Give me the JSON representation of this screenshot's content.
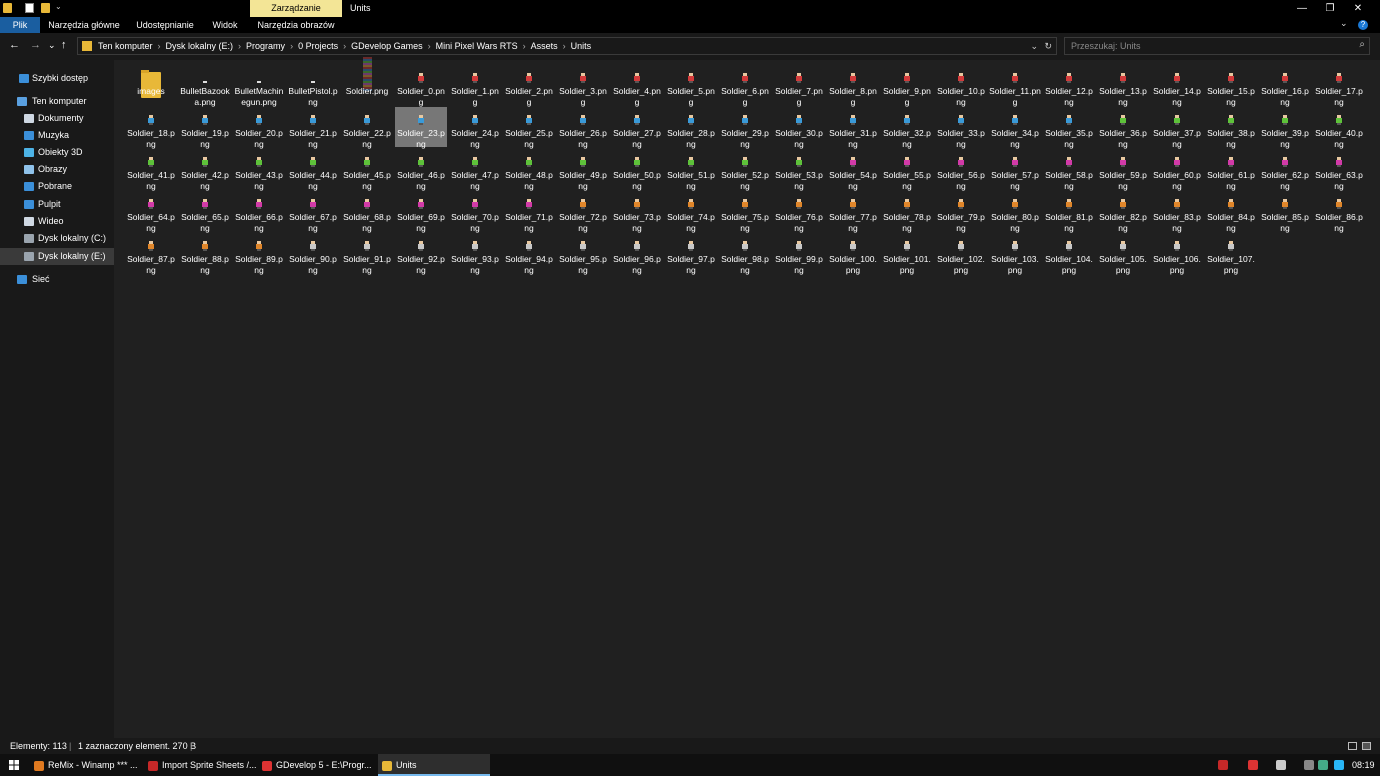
{
  "window": {
    "title": "Units",
    "contextual_group": "Zarządzanie",
    "controls": {
      "minimize": "—",
      "maximize": "❐",
      "close": "✕"
    }
  },
  "ribbon": {
    "tabs": [
      {
        "label": "Plik",
        "active": true
      },
      {
        "label": "Narzędzia główne"
      },
      {
        "label": "Udostępnianie"
      },
      {
        "label": "Widok"
      },
      {
        "label": "Narzędzia obrazów"
      }
    ],
    "collapse_glyph": "⌄",
    "help_glyph": "?"
  },
  "nav_buttons": {
    "back": "←",
    "forward": "→",
    "recent": "⌄",
    "up": "↑"
  },
  "address": {
    "crumbs": [
      "Ten komputer",
      "Dysk lokalny (E:)",
      "Programy",
      "0 Projects",
      "GDevelop Games",
      "Mini Pixel Wars RTS",
      "Assets",
      "Units"
    ],
    "separator": "›",
    "dropdown_glyph": "⌄",
    "refresh_glyph": "↻"
  },
  "search": {
    "placeholder": "Przeszukaj: Units",
    "icon_glyph": "⌕"
  },
  "sidebar": {
    "items": [
      {
        "label": "Szybki dostęp",
        "icon": "star-icon",
        "color": "#3b8fd9"
      },
      {
        "label": "Ten komputer",
        "icon": "computer-icon",
        "color": "#5aa0e0"
      },
      {
        "label": "Dokumenty",
        "icon": "document-icon",
        "color": "#cfd8e3"
      },
      {
        "label": "Muzyka",
        "icon": "music-icon",
        "color": "#3b8fd9"
      },
      {
        "label": "Obiekty 3D",
        "icon": "cube-icon",
        "color": "#4db3e6"
      },
      {
        "label": "Obrazy",
        "icon": "pictures-icon",
        "color": "#8fc2ea"
      },
      {
        "label": "Pobrane",
        "icon": "download-icon",
        "color": "#3b8fd9"
      },
      {
        "label": "Pulpit",
        "icon": "desktop-icon",
        "color": "#3b8fd9"
      },
      {
        "label": "Wideo",
        "icon": "video-icon",
        "color": "#cfd8e3"
      },
      {
        "label": "Dysk lokalny (C:)",
        "icon": "drive-icon",
        "color": "#9aa4ae"
      },
      {
        "label": "Dysk lokalny (E:)",
        "icon": "drive-icon",
        "color": "#9aa4ae",
        "selected": true
      },
      {
        "label": "Sieć",
        "icon": "network-icon",
        "color": "#3b8fd9"
      }
    ]
  },
  "files": {
    "selected_index": 28,
    "items": [
      {
        "name": "images",
        "kind": "folder"
      },
      {
        "name": "BulletBazooka.png",
        "kind": "bullet"
      },
      {
        "name": "BulletMachinegun.png",
        "kind": "bullet"
      },
      {
        "name": "BulletPistol.png",
        "kind": "bullet"
      },
      {
        "name": "Soldier.png",
        "kind": "sheet"
      },
      {
        "name": "Soldier_0.png"
      },
      {
        "name": "Soldier_1.png"
      },
      {
        "name": "Soldier_2.png"
      },
      {
        "name": "Soldier_3.png"
      },
      {
        "name": "Soldier_4.png"
      },
      {
        "name": "Soldier_5.png"
      },
      {
        "name": "Soldier_6.png"
      },
      {
        "name": "Soldier_7.png"
      },
      {
        "name": "Soldier_8.png"
      },
      {
        "name": "Soldier_9.png"
      },
      {
        "name": "Soldier_10.png"
      },
      {
        "name": "Soldier_11.png"
      },
      {
        "name": "Soldier_12.png"
      },
      {
        "name": "Soldier_13.png"
      },
      {
        "name": "Soldier_14.png"
      },
      {
        "name": "Soldier_15.png"
      },
      {
        "name": "Soldier_16.png"
      },
      {
        "name": "Soldier_17.png"
      },
      {
        "name": "Soldier_18.png"
      },
      {
        "name": "Soldier_19.png"
      },
      {
        "name": "Soldier_20.png"
      },
      {
        "name": "Soldier_21.png"
      },
      {
        "name": "Soldier_22.png"
      },
      {
        "name": "Soldier_23.png"
      },
      {
        "name": "Soldier_24.png"
      },
      {
        "name": "Soldier_25.png"
      },
      {
        "name": "Soldier_26.png"
      },
      {
        "name": "Soldier_27.png"
      },
      {
        "name": "Soldier_28.png"
      },
      {
        "name": "Soldier_29.png"
      },
      {
        "name": "Soldier_30.png"
      },
      {
        "name": "Soldier_31.png"
      },
      {
        "name": "Soldier_32.png"
      },
      {
        "name": "Soldier_33.png"
      },
      {
        "name": "Soldier_34.png"
      },
      {
        "name": "Soldier_35.png"
      },
      {
        "name": "Soldier_36.png"
      },
      {
        "name": "Soldier_37.png"
      },
      {
        "name": "Soldier_38.png"
      },
      {
        "name": "Soldier_39.png"
      },
      {
        "name": "Soldier_40.png"
      },
      {
        "name": "Soldier_41.png"
      },
      {
        "name": "Soldier_42.png"
      },
      {
        "name": "Soldier_43.png"
      },
      {
        "name": "Soldier_44.png"
      },
      {
        "name": "Soldier_45.png"
      },
      {
        "name": "Soldier_46.png"
      },
      {
        "name": "Soldier_47.png"
      },
      {
        "name": "Soldier_48.png"
      },
      {
        "name": "Soldier_49.png"
      },
      {
        "name": "Soldier_50.png"
      },
      {
        "name": "Soldier_51.png"
      },
      {
        "name": "Soldier_52.png"
      },
      {
        "name": "Soldier_53.png"
      },
      {
        "name": "Soldier_54.png"
      },
      {
        "name": "Soldier_55.png"
      },
      {
        "name": "Soldier_56.png"
      },
      {
        "name": "Soldier_57.png"
      },
      {
        "name": "Soldier_58.png"
      },
      {
        "name": "Soldier_59.png"
      },
      {
        "name": "Soldier_60.png"
      },
      {
        "name": "Soldier_61.png"
      },
      {
        "name": "Soldier_62.png"
      },
      {
        "name": "Soldier_63.png"
      },
      {
        "name": "Soldier_64.png"
      },
      {
        "name": "Soldier_65.png"
      },
      {
        "name": "Soldier_66.png"
      },
      {
        "name": "Soldier_67.png"
      },
      {
        "name": "Soldier_68.png"
      },
      {
        "name": "Soldier_69.png"
      },
      {
        "name": "Soldier_70.png"
      },
      {
        "name": "Soldier_71.png"
      },
      {
        "name": "Soldier_72.png"
      },
      {
        "name": "Soldier_73.png"
      },
      {
        "name": "Soldier_74.png"
      },
      {
        "name": "Soldier_75.png"
      },
      {
        "name": "Soldier_76.png"
      },
      {
        "name": "Soldier_77.png"
      },
      {
        "name": "Soldier_78.png"
      },
      {
        "name": "Soldier_79.png"
      },
      {
        "name": "Soldier_80.png"
      },
      {
        "name": "Soldier_81.png"
      },
      {
        "name": "Soldier_82.png"
      },
      {
        "name": "Soldier_83.png"
      },
      {
        "name": "Soldier_84.png"
      },
      {
        "name": "Soldier_85.png"
      },
      {
        "name": "Soldier_86.png"
      },
      {
        "name": "Soldier_87.png"
      },
      {
        "name": "Soldier_88.png"
      },
      {
        "name": "Soldier_89.png"
      },
      {
        "name": "Soldier_90.png"
      },
      {
        "name": "Soldier_91.png"
      },
      {
        "name": "Soldier_92.png"
      },
      {
        "name": "Soldier_93.png"
      },
      {
        "name": "Soldier_94.png"
      },
      {
        "name": "Soldier_95.png"
      },
      {
        "name": "Soldier_96.png"
      },
      {
        "name": "Soldier_97.png"
      },
      {
        "name": "Soldier_98.png"
      },
      {
        "name": "Soldier_99.png"
      },
      {
        "name": "Soldier_100.png"
      },
      {
        "name": "Soldier_101.png"
      },
      {
        "name": "Soldier_102.png"
      },
      {
        "name": "Soldier_103.png"
      },
      {
        "name": "Soldier_104.png"
      },
      {
        "name": "Soldier_105.png"
      },
      {
        "name": "Soldier_106.png"
      },
      {
        "name": "Soldier_107.png"
      }
    ],
    "sprite_palette": [
      {
        "from": 0,
        "to": 17,
        "color": "#d23a3a"
      },
      {
        "from": 18,
        "to": 35,
        "color": "#3a9ad8"
      },
      {
        "from": 36,
        "to": 53,
        "color": "#5ec23a"
      },
      {
        "from": 54,
        "to": 71,
        "color": "#d23aa8"
      },
      {
        "from": 72,
        "to": 89,
        "color": "#e0862a"
      },
      {
        "from": 90,
        "to": 107,
        "color": "#c8c8c8"
      }
    ]
  },
  "status": {
    "count": "Elementy: 113",
    "selection": "1 zaznaczony element. 270 B"
  },
  "taskbar": {
    "start_glyph": "⊞",
    "items": [
      {
        "label": "ReMix - Winamp *** ...",
        "icon_color": "#e07a20"
      },
      {
        "label": "Import Sprite Sheets /...",
        "icon_color": "#c62828"
      },
      {
        "label": "GDevelop 5 - E:\\Progr...",
        "icon_color": "#d33"
      },
      {
        "label": "Units",
        "icon_color": "#e8b838",
        "active": true
      }
    ],
    "tray_colors": [
      "#c62828",
      "#d33",
      "#888",
      "#4a8",
      "#29b6f6",
      "#ccc"
    ],
    "clock": "08:19"
  }
}
